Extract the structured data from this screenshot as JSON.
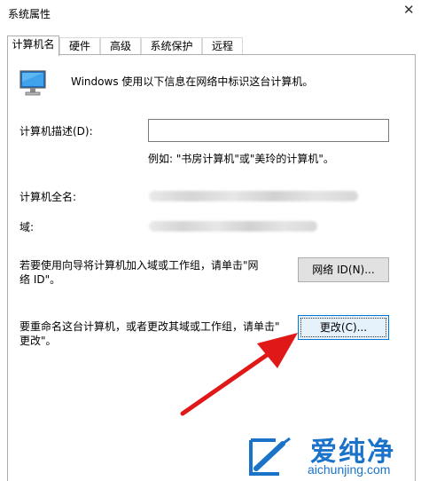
{
  "window": {
    "title": "系统属性"
  },
  "tabs": [
    {
      "label": "计算机名",
      "active": true
    },
    {
      "label": "硬件",
      "active": false
    },
    {
      "label": "高级",
      "active": false
    },
    {
      "label": "系统保护",
      "active": false
    },
    {
      "label": "远程",
      "active": false
    }
  ],
  "intro": {
    "text": "Windows 使用以下信息在网络中标识这台计算机。",
    "icon": "computer-icon"
  },
  "description": {
    "label": "计算机描述(D):",
    "value": "",
    "example": "例如: \"书房计算机\"或\"美玲的计算机\"。"
  },
  "full_name": {
    "label": "计算机全名:"
  },
  "domain": {
    "label": "域:"
  },
  "network_id": {
    "line1": "若要使用向导将计算机加入域或工作组，请单击\"网",
    "line2": "络 ID\"。",
    "button": "网络 ID(N)..."
  },
  "rename": {
    "line1": "要重命名这台计算机，或者更改其域或工作组，请单击\"",
    "line2": "更改\"。",
    "button": "更改(C)..."
  },
  "annotation": {
    "color": "#e01818"
  },
  "watermark": {
    "brand": "爱纯净",
    "url": "aichunjing.com",
    "color": "#1a73c9"
  }
}
